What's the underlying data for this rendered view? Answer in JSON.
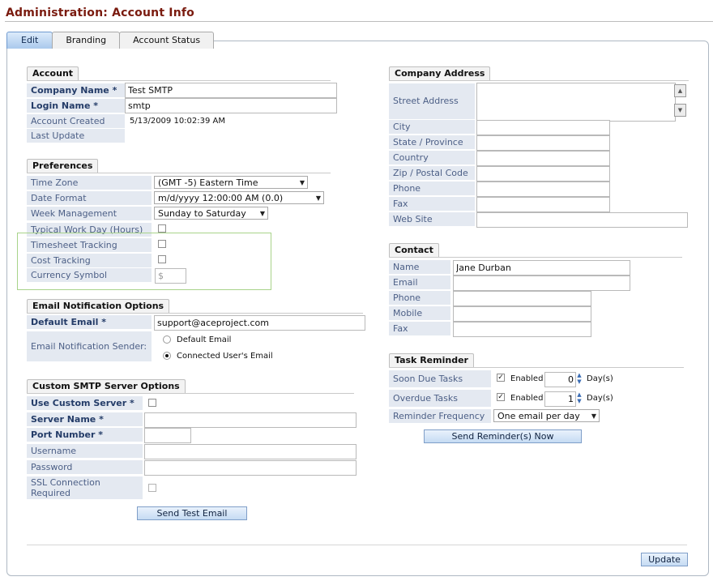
{
  "page": {
    "title": "Administration: Account Info"
  },
  "tabs": [
    {
      "label": "Edit",
      "active": true
    },
    {
      "label": "Branding"
    },
    {
      "label": "Account Status"
    }
  ],
  "account": {
    "heading": "Account",
    "company_name_label": "Company Name *",
    "company_name_value": "Test SMTP",
    "login_name_label": "Login Name *",
    "login_name_value": "smtp",
    "account_created_label": "Account Created",
    "account_created_value": "5/13/2009 10:02:39 AM",
    "last_update_label": "Last Update",
    "last_update_value": ""
  },
  "preferences": {
    "heading": "Preferences",
    "time_zone_label": "Time Zone",
    "time_zone_value": "(GMT -5) Eastern Time",
    "date_format_label": "Date Format",
    "date_format_value": "m/d/yyyy 12:00:00 AM (0.0)",
    "week_mgmt_label": "Week Management",
    "week_mgmt_value": "Sunday to Saturday",
    "typical_day_label": "Typical Work Day (Hours)",
    "timesheet_label": "Timesheet Tracking",
    "cost_label": "Cost Tracking",
    "currency_label": "Currency Symbol",
    "currency_value": "$"
  },
  "email": {
    "heading": "Email Notification Options",
    "default_email_label": "Default Email *",
    "default_email_value": "support@aceproject.com",
    "sender_label": "Email Notification Sender:",
    "option_default": "Default Email",
    "option_connected": "Connected User's Email",
    "selected": "connected"
  },
  "smtp": {
    "heading": "Custom SMTP Server Options",
    "use_custom_label": "Use Custom Server *",
    "server_name_label": "Server Name *",
    "server_name_value": "",
    "port_label": "Port Number *",
    "port_value": "",
    "username_label": "Username",
    "username_value": "",
    "password_label": "Password",
    "password_value": "",
    "ssl_label_1": "SSL Connection",
    "ssl_label_2": "Required",
    "send_test_label": "Send Test Email"
  },
  "company_address": {
    "heading": "Company Address",
    "street_label": "Street Address",
    "street_value": "",
    "city_label": "City",
    "city_value": "",
    "state_label": "State / Province",
    "state_value": "",
    "country_label": "Country",
    "country_value": "",
    "zip_label": "Zip / Postal Code",
    "zip_value": "",
    "phone_label": "Phone",
    "phone_value": "",
    "fax_label": "Fax",
    "fax_value": "",
    "website_label": "Web Site",
    "website_value": ""
  },
  "contact": {
    "heading": "Contact",
    "name_label": "Name",
    "name_value": "Jane Durban",
    "email_label": "Email",
    "email_value": "",
    "phone_label": "Phone",
    "phone_value": "",
    "mobile_label": "Mobile",
    "mobile_value": "",
    "fax_label": "Fax",
    "fax_value": ""
  },
  "task_reminder": {
    "heading": "Task Reminder",
    "soon_due_label": "Soon Due Tasks",
    "overdue_label": "Overdue Tasks",
    "enabled_label": "Enabled",
    "soon_due_days": "0",
    "overdue_days": "1",
    "days_label": "Day(s)",
    "frequency_label": "Reminder Frequency",
    "frequency_value": "One email per day",
    "send_now_label": "Send Reminder(s) Now"
  },
  "footer": {
    "update_label": "Update"
  },
  "colors": {
    "title": "#7a1b0f",
    "label_bg": "#e4e9f1",
    "highlight_box": "#a8d38a"
  }
}
